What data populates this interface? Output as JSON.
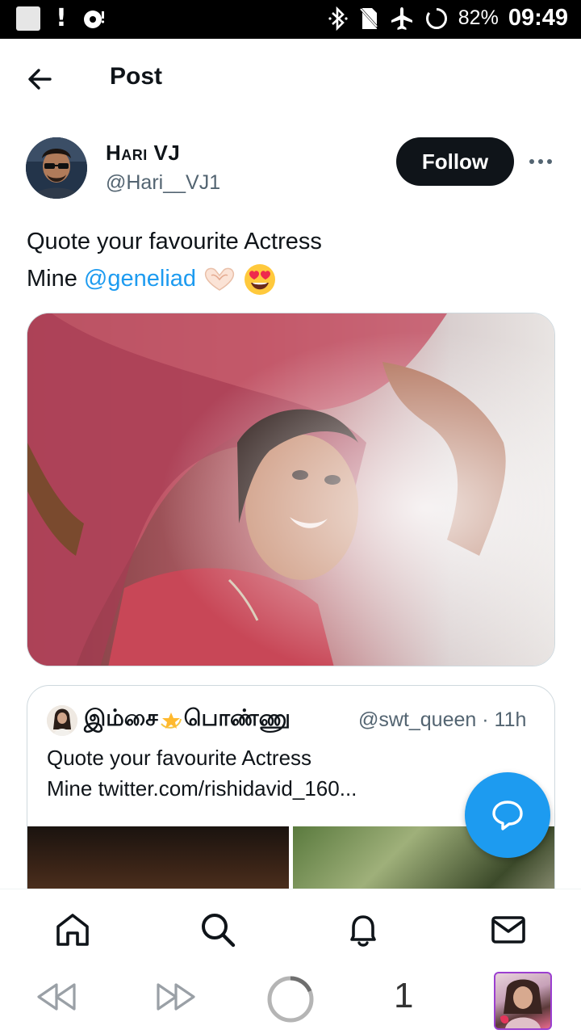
{
  "status_bar": {
    "battery": "82%",
    "time": "09:49",
    "icons": [
      "notification-square-icon",
      "alert-icon",
      "dnd-icon",
      "bluetooth-icon",
      "no-sim-icon",
      "airplane-icon",
      "battery-ring-icon"
    ]
  },
  "header": {
    "title": "Post",
    "back_icon": "arrow-left-icon"
  },
  "tweet": {
    "author_name": "Hari VJ",
    "author_handle": "@Hari__VJ1",
    "follow_label": "Follow",
    "line1": "Quote your favourite Actress",
    "line2_prefix": "Mine ",
    "mention": "@geneliad",
    "emojis": [
      "heart-hands-emoji",
      "heart-eyes-emoji"
    ]
  },
  "quote": {
    "name_part1": "இம்சை",
    "name_emoji": "dizzy-star-emoji",
    "name_part2": "பொண்ணு",
    "meta": "@swt_queen · 11h",
    "line1": "Quote your favourite Actress",
    "line2": "Mine  twitter.com/rishidavid_160..."
  },
  "fab": {
    "icon": "reply-bubble-icon"
  },
  "bottom_nav": {
    "items": [
      "home-icon",
      "search-icon",
      "notifications-icon",
      "messages-icon"
    ]
  },
  "browser_bar": {
    "tab_count": "1",
    "items": [
      "rewind-icon",
      "fast-forward-icon",
      "reload-icon"
    ]
  },
  "colors": {
    "accent": "#1d9bf0",
    "text": "#0f1419",
    "secondary_text": "#536471",
    "follow_bg": "#0f1419"
  }
}
